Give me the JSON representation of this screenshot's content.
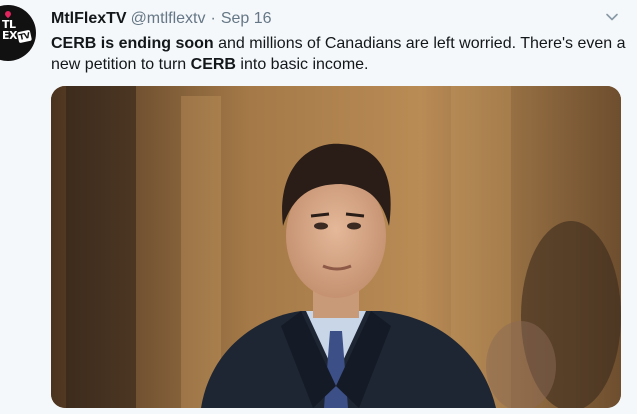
{
  "account": {
    "display_name": "MtlFlexTV",
    "handle": "@mtlflextv",
    "separator": "·",
    "date": "Sep 16",
    "avatar_label": "TL",
    "avatar_label2": "EX",
    "avatar_badge": "TV"
  },
  "tweet": {
    "bold1": "CERB is ending soon",
    "text1": " and millions of Canadians are left worried. There's even a new petition to turn ",
    "bold2": "CERB",
    "text2": " into basic income."
  },
  "icons": {
    "caret": "chevron-down-icon"
  },
  "colors": {
    "background": "#f5f8fa",
    "name": "#14171a",
    "muted": "#657786"
  }
}
